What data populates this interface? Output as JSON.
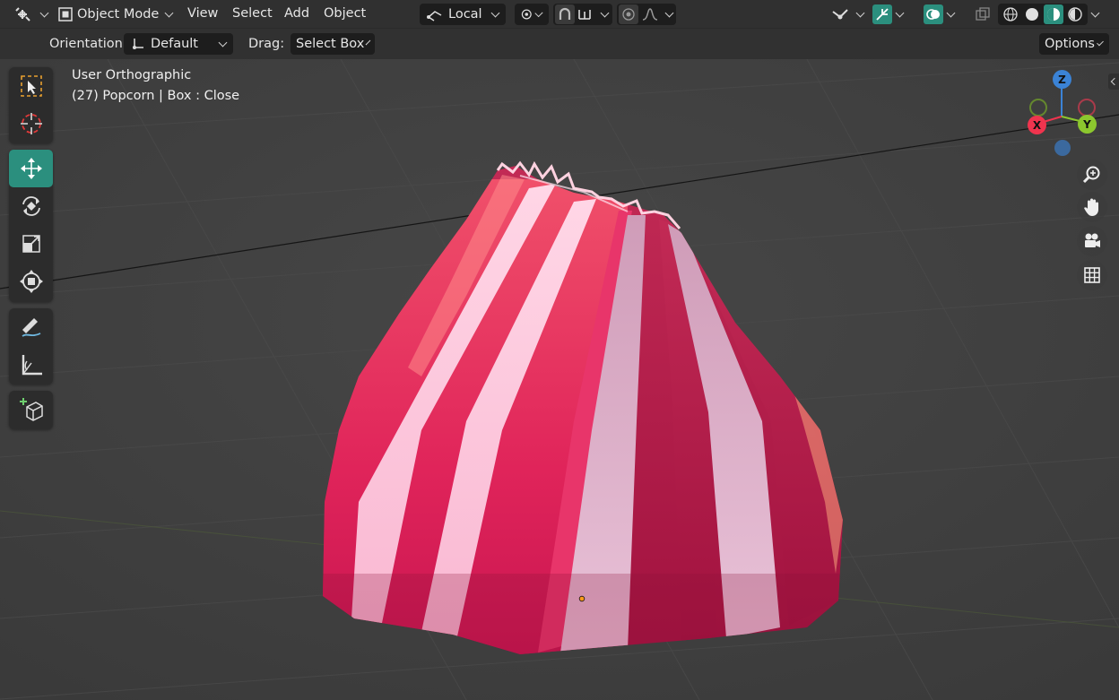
{
  "header": {
    "mode_label": "Object Mode",
    "menus": [
      "View",
      "Select",
      "Add",
      "Object"
    ],
    "transform_orientation": "Local",
    "options_label": "Options"
  },
  "tool_settings": {
    "orientation_label": "Orientation:",
    "orientation_value": "Default",
    "drag_label": "Drag:",
    "drag_value": "Select Box"
  },
  "viewport": {
    "view_name": "User Orthographic",
    "object_info": "(27) Popcorn | Box : Close"
  },
  "gizmo": {
    "axes": [
      "Z",
      "X",
      "Y"
    ],
    "colors": {
      "x": "#f0344e",
      "y": "#8cc72e",
      "z": "#3b83d6",
      "accent": "#2b8f7e"
    }
  },
  "toolbar": {
    "tools": [
      "select-box",
      "cursor",
      "move",
      "rotate",
      "scale",
      "transform",
      "annotate",
      "measure",
      "add-cube"
    ],
    "active": "move"
  }
}
